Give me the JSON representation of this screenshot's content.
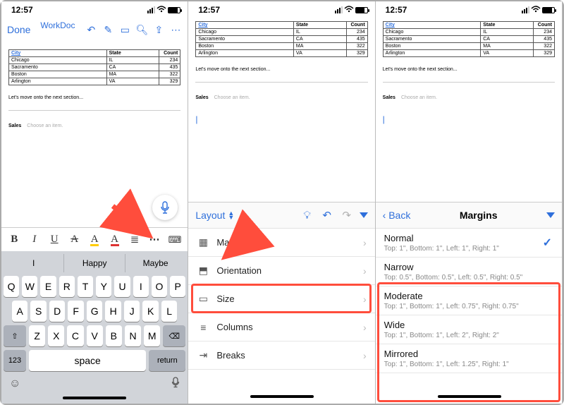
{
  "status": {
    "time": "12:57"
  },
  "toolbar": {
    "done": "Done",
    "title": "WorkDoc"
  },
  "table": {
    "headers": [
      "City",
      "State",
      "Count"
    ],
    "rows": [
      [
        "Chicago",
        "IL",
        "234"
      ],
      [
        "Sacramento",
        "CA",
        "435"
      ],
      [
        "Boston",
        "MA",
        "322"
      ],
      [
        "Arlington",
        "VA",
        "329"
      ]
    ]
  },
  "body_text": "Let's move onto the next section...",
  "sales": {
    "label": "Sales",
    "hint": "Choose an item."
  },
  "suggestions": [
    "I",
    "Happy",
    "Maybe"
  ],
  "keys": {
    "r1": [
      "Q",
      "W",
      "E",
      "R",
      "T",
      "Y",
      "U",
      "I",
      "O",
      "P"
    ],
    "r2": [
      "A",
      "S",
      "D",
      "F",
      "G",
      "H",
      "J",
      "K",
      "L"
    ],
    "r3": [
      "Z",
      "X",
      "C",
      "V",
      "B",
      "N",
      "M"
    ],
    "num": "123",
    "space": "space",
    "return": "return"
  },
  "layout_panel": {
    "title": "Layout",
    "items": [
      {
        "icon": "margins",
        "label": "Margins"
      },
      {
        "icon": "orientation",
        "label": "Orientation"
      },
      {
        "icon": "size",
        "label": "Size"
      },
      {
        "icon": "columns",
        "label": "Columns"
      },
      {
        "icon": "breaks",
        "label": "Breaks"
      }
    ]
  },
  "margins_panel": {
    "back": "Back",
    "title": "Margins",
    "options": [
      {
        "name": "Normal",
        "desc": "Top: 1\", Bottom: 1\", Left: 1\", Right: 1\"",
        "selected": true
      },
      {
        "name": "Narrow",
        "desc": "Top: 0.5\", Bottom: 0.5\", Left: 0.5\", Right: 0.5\"",
        "selected": false
      },
      {
        "name": "Moderate",
        "desc": "Top: 1\", Bottom: 1\", Left: 0.75\", Right: 0.75\"",
        "selected": false
      },
      {
        "name": "Wide",
        "desc": "Top: 1\", Bottom: 1\", Left: 2\", Right: 2\"",
        "selected": false
      },
      {
        "name": "Mirrored",
        "desc": "Top: 1\", Bottom: 1\", Left: 1.25\", Right: 1\"",
        "selected": false
      }
    ]
  }
}
